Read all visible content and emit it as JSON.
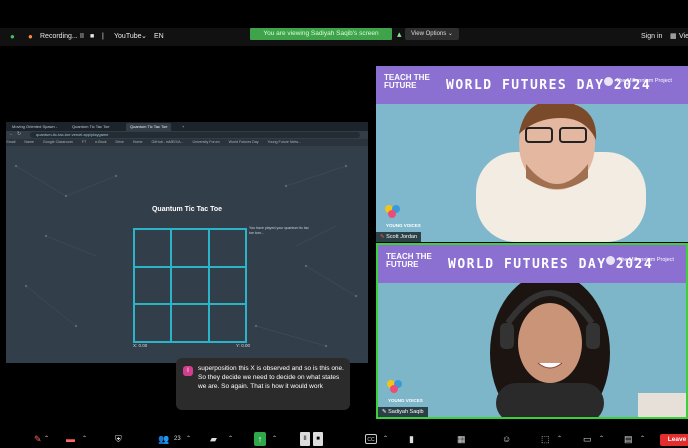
{
  "top_bar": {
    "recording_label": "Recording...",
    "pause_icon": "II",
    "stop_icon": "■",
    "youtube_label": "YouTube",
    "language": "EN",
    "viewing_banner": "You are viewing Sadiyah Saqib's screen",
    "view_options": "View Options",
    "sign_in": "Sign in",
    "view_label": "View"
  },
  "shared_screen": {
    "browser": {
      "tabs": [
        "Moving Oriented Spawn - ",
        "Quantum Tic Tac Toe",
        "Quantum Tic Tac Toe"
      ],
      "new_tab": "+",
      "url": "quantum-tic-tac-toe.vercel.app/playgame",
      "bookmarks": [
        "Gmail",
        "Name",
        "Google Classroom",
        "FT",
        "e-Book",
        "Drive",
        "Home",
        "GitHub - rsMEG/A...",
        "University Forum",
        "World Futures Day",
        "Young Future Netw..."
      ]
    },
    "game": {
      "title": "Quantum Tic Tac Toe",
      "note": "You have played your quantum tic tac toe turn...",
      "score_x": "X: 0.00",
      "score_y": "Y: 0.00"
    }
  },
  "participants": [
    {
      "name": "Scott Jordan",
      "banner_left": "TEACH THE FUTURE",
      "banner_center": "WORLD FUTURES DAY 2024",
      "banner_right": "The Millennium Project",
      "badge": "YOUNG VOICES"
    },
    {
      "name": "Sadiyah Saqib",
      "banner_left": "TEACH THE FUTURE",
      "banner_center": "WORLD FUTURES DAY 2024",
      "banner_right": "The Millennium Project",
      "badge": "YOUNG VOICES"
    }
  ],
  "caption": {
    "avatar_initial": "I",
    "text": "superposition this X is observed and so is this one. So they decide we need to decide on what states we are. So again. That is how it would work"
  },
  "toolbar": {
    "participants_count": "23",
    "leave_label": "Leave",
    "cc_label": "CC",
    "icons": [
      "mic-off-icon",
      "video-off-icon",
      "security-icon",
      "participants-icon",
      "chat-icon",
      "share-screen-icon",
      "pause-share-icon",
      "captions-icon",
      "polls-icon",
      "apps-icon",
      "reactions-icon",
      "whiteboard-icon",
      "more-icon"
    ]
  },
  "colors": {
    "share_active": "#3ea34a",
    "leave": "#e22e2e",
    "active_speaker": "#3bd13b",
    "grid_line": "#2bb3c7",
    "banner": "#8b6fd1"
  }
}
